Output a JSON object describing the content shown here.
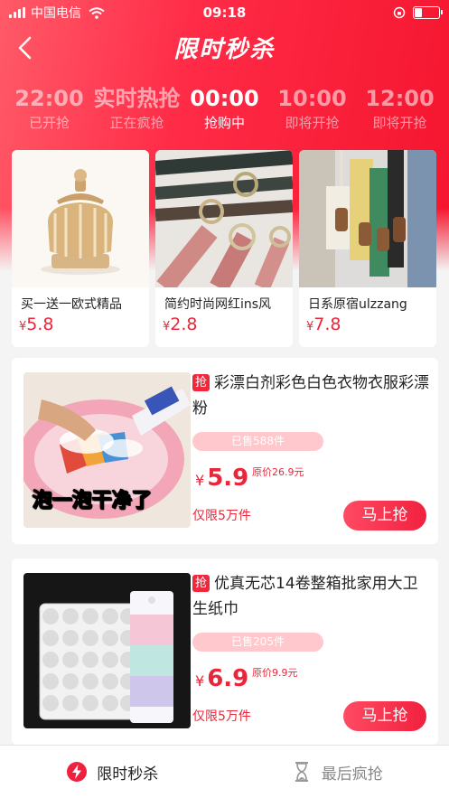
{
  "status_bar": {
    "carrier": "中国电信",
    "time": "09:18"
  },
  "header": {
    "title": "限时秒杀"
  },
  "time_tabs": [
    {
      "time": "22:00",
      "status": "已开抢"
    },
    {
      "time": "实时热抢",
      "status": "正在疯抢"
    },
    {
      "time": "00:00",
      "status": "抢购中"
    },
    {
      "time": "10:00",
      "status": "即将开抢"
    },
    {
      "time": "12:00",
      "status": "即将开抢"
    }
  ],
  "featured": [
    {
      "name": "买一送一欧式精品",
      "currency": "¥",
      "price": "5.8"
    },
    {
      "name": "简约时尚网红ins风",
      "currency": "¥",
      "price": "2.8"
    },
    {
      "name": "日系原宿ulzzang",
      "currency": "¥",
      "price": "7.8"
    }
  ],
  "products": [
    {
      "badge": "抢",
      "title": "彩漂白剂彩色白色衣物衣服彩漂粉",
      "sold": "已售588件",
      "currency": "¥",
      "price": "5.9",
      "original": "原价26.9元",
      "limit": "仅限5万件",
      "button": "马上抢",
      "image_caption": "泡一泡干净了"
    },
    {
      "badge": "抢",
      "title": "优真无芯14卷整箱批家用大卫生纸巾",
      "sold": "已售205件",
      "currency": "¥",
      "price": "6.9",
      "original": "原价9.9元",
      "limit": "仅限5万件",
      "button": "马上抢"
    }
  ],
  "bottom_tabs": [
    {
      "label": "限时秒杀",
      "icon": "lightning-icon"
    },
    {
      "label": "最后疯抢",
      "icon": "hourglass-icon"
    }
  ],
  "colors": {
    "brand_red": "#f0213e",
    "price_red": "#e8283a"
  }
}
